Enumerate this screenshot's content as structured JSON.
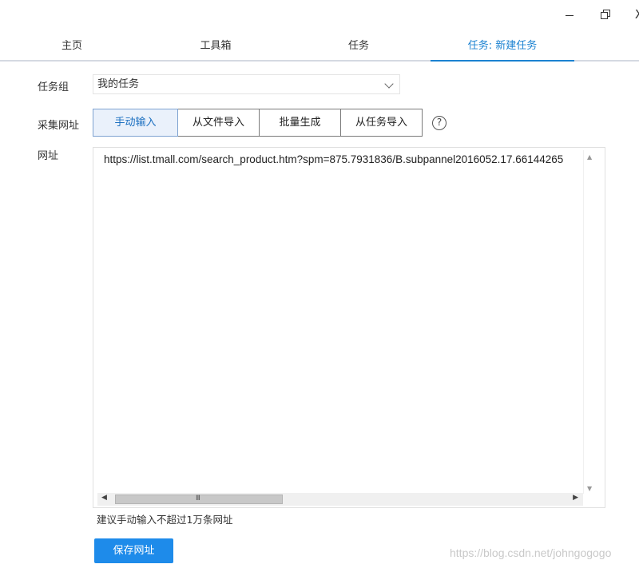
{
  "window": {
    "minimize_icon": "minimize-icon",
    "restore_icon": "restore-icon",
    "close_glyph": "X"
  },
  "tabs": [
    {
      "label": "主页"
    },
    {
      "label": "工具箱"
    },
    {
      "label": "任务"
    },
    {
      "label": "任务: 新建任务",
      "active": true
    }
  ],
  "form": {
    "task_group_label": "任务组",
    "task_group_value": "我的任务",
    "collect_url_label": "采集网址",
    "url_label": "网址",
    "modes": [
      {
        "label": "手动输入",
        "active": true
      },
      {
        "label": "从文件导入"
      },
      {
        "label": "批量生成"
      },
      {
        "label": "从任务导入"
      }
    ],
    "help_glyph": "?",
    "url_value": "https://list.tmall.com/search_product.htm?spm=875.7931836/B.subpannel2016052.17.66144265",
    "hint": "建议手动输入不超过1万条网址",
    "save_label": "保存网址"
  },
  "scrollbar": {
    "grip": "III"
  },
  "watermark": "https://blog.csdn.net/johngogogo",
  "colors": {
    "accent": "#1b82d1",
    "button": "#1e8bea",
    "active_segment_bg": "#eaf1fb"
  }
}
